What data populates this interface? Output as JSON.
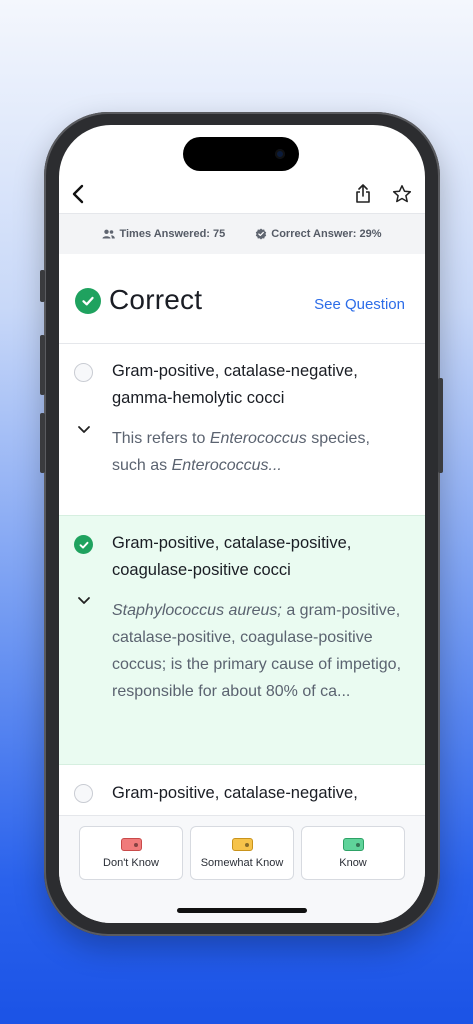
{
  "stats": {
    "times_answered": "Times Answered: 75",
    "correct_answer": "Correct Answer: 29%"
  },
  "result": {
    "title": "Correct",
    "see_question": "See Question"
  },
  "options": [
    {
      "title": "Gram-positive, catalase-negative, gamma-hemolytic cocci",
      "desc_prefix": "This refers to ",
      "desc_italic": "Enterococcus",
      "desc_mid": " species, such as ",
      "desc_italic2": "Enterococcus...",
      "state": "unselected"
    },
    {
      "title": "Gram-positive, catalase-positive, coagulase-positive cocci",
      "desc_italic": "Staphylococcus aureus;",
      "desc_rest": " a gram-positive, catalase-positive, coagulase-positive coccus; is the primary cause of impetigo, responsible for about 80% of ca...",
      "state": "correct"
    },
    {
      "title": "Gram-positive, catalase-negative,",
      "state": "unselected"
    }
  ],
  "rating": {
    "dont_know": "Don't Know",
    "somewhat_know": "Somewhat Know",
    "know": "Know"
  },
  "colors": {
    "correct_green": "#1fa25f",
    "link_blue": "#2d6de8",
    "tag_red": "#f07b7b",
    "tag_yellow": "#f6c34a",
    "tag_green": "#5fd39a"
  },
  "icons": {
    "back": "chevron-left-icon",
    "share": "share-icon",
    "favorite": "star-icon",
    "users": "users-icon",
    "verified": "verified-badge-icon"
  }
}
